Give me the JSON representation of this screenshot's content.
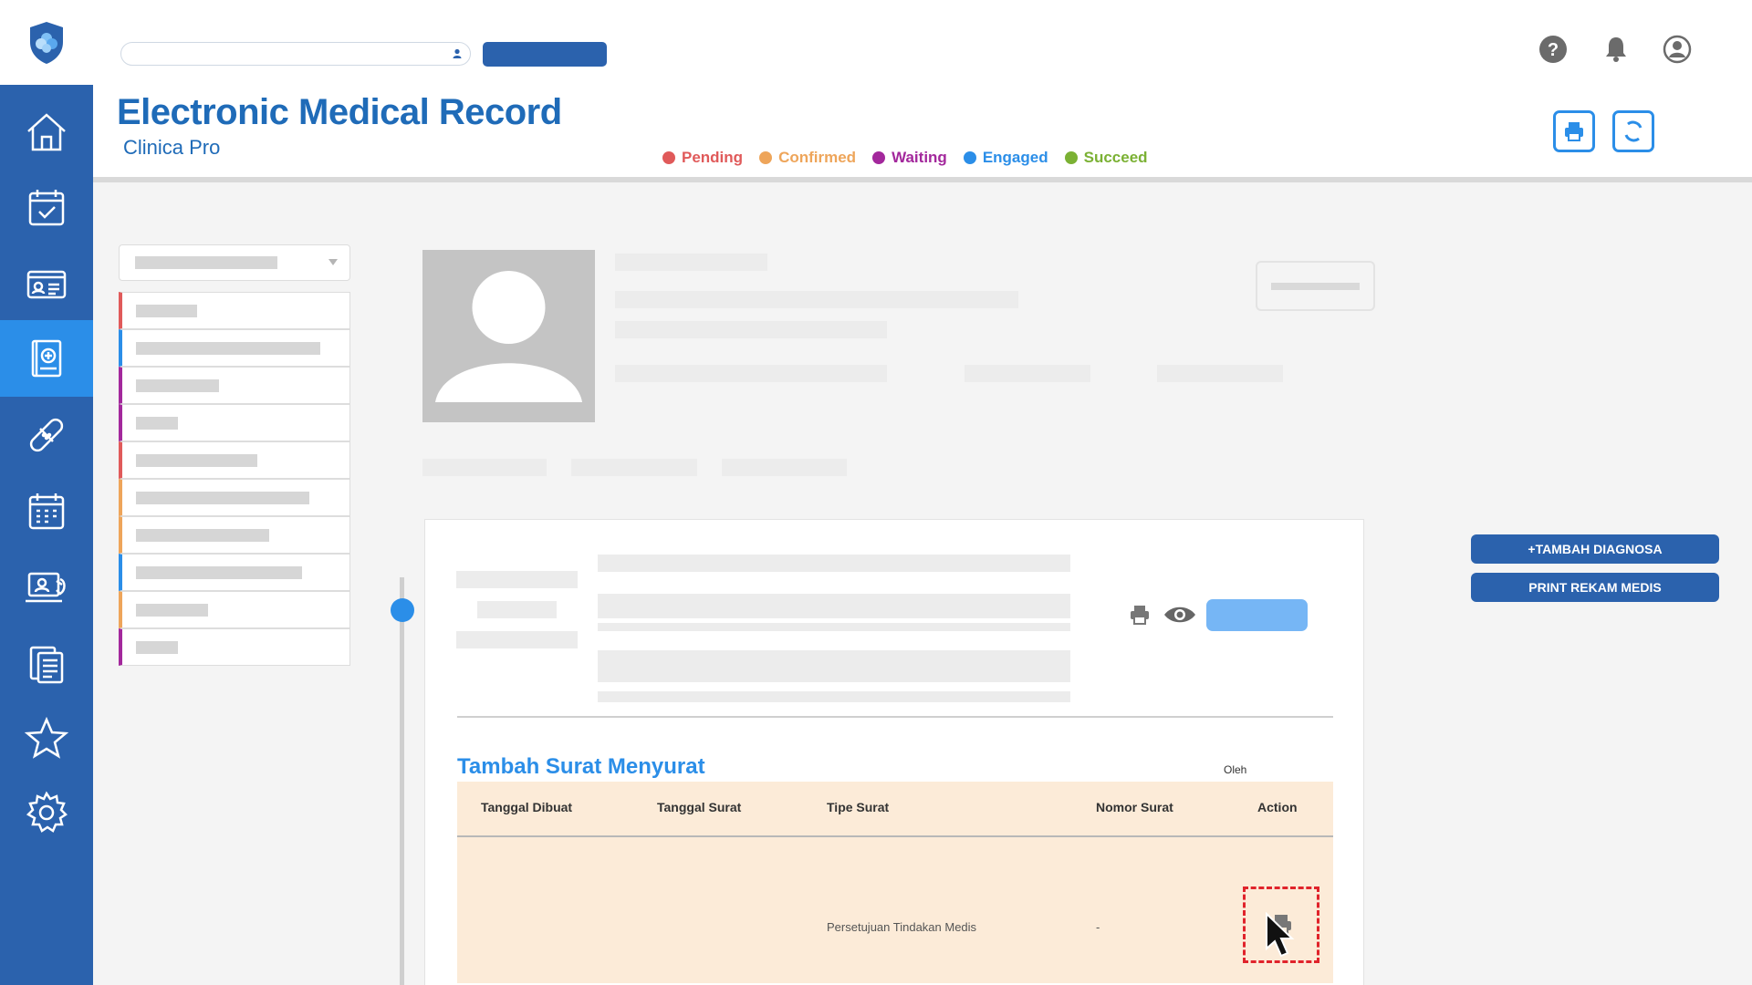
{
  "search": {
    "value": "",
    "button_label": ""
  },
  "header": {
    "title": "Electronic Medical Record",
    "subtitle": "Clinica Pro"
  },
  "legend": [
    {
      "label": "Pending",
      "color": "#e05a5a"
    },
    {
      "label": "Confirmed",
      "color": "#eea55a"
    },
    {
      "label": "Waiting",
      "color": "#a3289c"
    },
    {
      "label": "Engaged",
      "color": "#2b8ee8"
    },
    {
      "label": "Succeed",
      "color": "#7bb134"
    }
  ],
  "sidebar": {
    "items": [
      {
        "icon": "home-icon"
      },
      {
        "icon": "calendar-check-icon"
      },
      {
        "icon": "id-card-icon"
      },
      {
        "icon": "medical-record-icon",
        "active": true
      },
      {
        "icon": "bandage-icon"
      },
      {
        "icon": "schedule-icon"
      },
      {
        "icon": "telemedicine-icon"
      },
      {
        "icon": "clipboard-icon"
      },
      {
        "icon": "star-icon"
      },
      {
        "icon": "gear-icon"
      }
    ]
  },
  "list_colors": [
    "#e05a5a",
    "#2b8ee8",
    "#a3289c",
    "#a3289c",
    "#e05a5a",
    "#eea55a",
    "#eea55a",
    "#2b8ee8",
    "#eea55a",
    "#a3289c"
  ],
  "section": {
    "title": "Tambah Surat Menyurat",
    "by_label": "Oleh"
  },
  "table": {
    "columns": [
      "Tanggal Dibuat",
      "Tanggal Surat",
      "Tipe Surat",
      "Nomor Surat",
      "Action"
    ],
    "rows": [
      {
        "tanggal_dibuat": "",
        "tanggal_surat": "",
        "tipe_surat": "Persetujuan Tindakan Medis",
        "nomor_surat": "-"
      }
    ]
  },
  "actions": {
    "add_diagnosis": "+TAMBAH DIAGNOSA",
    "print_record": "PRINT REKAM MEDIS"
  },
  "colors": {
    "primary": "#2b62ad",
    "accent": "#2b8ee8",
    "title": "#1f6bb8",
    "table_bg": "#fcebd8",
    "highlight": "#e0232b"
  }
}
